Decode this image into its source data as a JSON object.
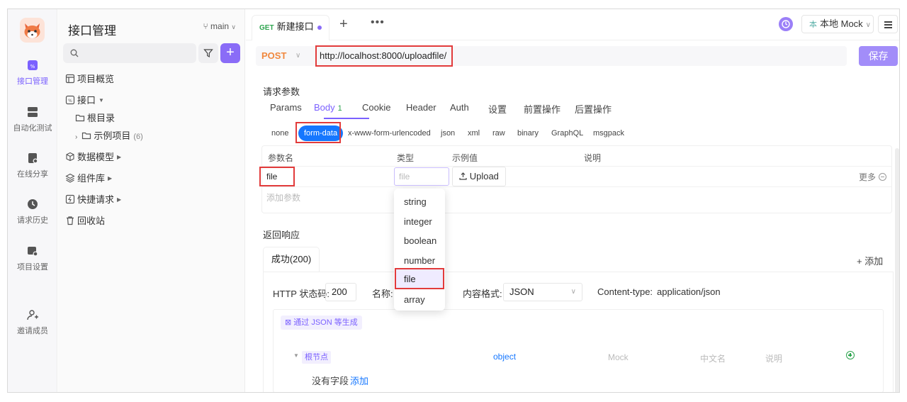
{
  "rail": {
    "items": [
      {
        "label": "接口管理",
        "icon": "api-icon",
        "active": true
      },
      {
        "label": "自动化测试",
        "icon": "server-icon"
      },
      {
        "label": "在线分享",
        "icon": "share-icon"
      },
      {
        "label": "请求历史",
        "icon": "history-icon"
      },
      {
        "label": "项目设置",
        "icon": "settings-icon"
      },
      {
        "label": "邀请成员",
        "icon": "add-member-icon"
      }
    ]
  },
  "sidebar": {
    "title": "接口管理",
    "branch": "main",
    "tree": [
      {
        "label": "项目概览",
        "icon": "overview-icon"
      },
      {
        "label": "接口",
        "icon": "api-small-icon"
      },
      {
        "label": "根目录",
        "icon": "folder-icon"
      },
      {
        "label": "示例项目",
        "icon": "folder-icon",
        "count": "(6)"
      },
      {
        "label": "数据模型",
        "icon": "cube-icon"
      },
      {
        "label": "组件库",
        "icon": "layers-icon"
      },
      {
        "label": "快捷请求",
        "icon": "quick-request-icon"
      },
      {
        "label": "回收站",
        "icon": "trash-icon"
      }
    ]
  },
  "tabs": {
    "current": {
      "method": "GET",
      "label": "新建接口"
    },
    "plus": "+",
    "more": "•••"
  },
  "env": {
    "badge": "本",
    "label": "本地 Mock"
  },
  "request": {
    "method": "POST",
    "url": "http://localhost:8000/uploadfile/",
    "save_label": "保存"
  },
  "params": {
    "section_title": "请求参数",
    "tabs": [
      "Params",
      "Body",
      "Cookie",
      "Header",
      "Auth",
      "设置",
      "前置操作",
      "后置操作"
    ],
    "body_badge": "1",
    "body_types": [
      "none",
      "form-data",
      "x-www-form-urlencoded",
      "json",
      "xml",
      "raw",
      "binary",
      "GraphQL",
      "msgpack"
    ],
    "table_headers": [
      "参数名",
      "类型",
      "示例值",
      "说明"
    ],
    "row": {
      "name": "file",
      "type_placeholder": "file",
      "upload_label": "Upload",
      "more_label": "更多"
    },
    "add_param": "添加参数",
    "type_options": [
      "string",
      "integer",
      "boolean",
      "number",
      "file",
      "array"
    ]
  },
  "response": {
    "section_title": "返回响应",
    "tab_label": "成功(200)",
    "add_label": "+ 添加",
    "status_label": "HTTP 状态码:",
    "status_value": "200",
    "name_label": "名称:",
    "format_label": "内容格式:",
    "format_value": "JSON",
    "content_type_label": "Content-type:",
    "content_type_value": "application/json",
    "gen_label": "通过 JSON 等生成",
    "root_label": "根节点",
    "root_type": "object",
    "col_mock": "Mock",
    "col_cn": "中文名",
    "col_desc": "说明",
    "no_field": "没有字段",
    "add_link": "添加"
  }
}
